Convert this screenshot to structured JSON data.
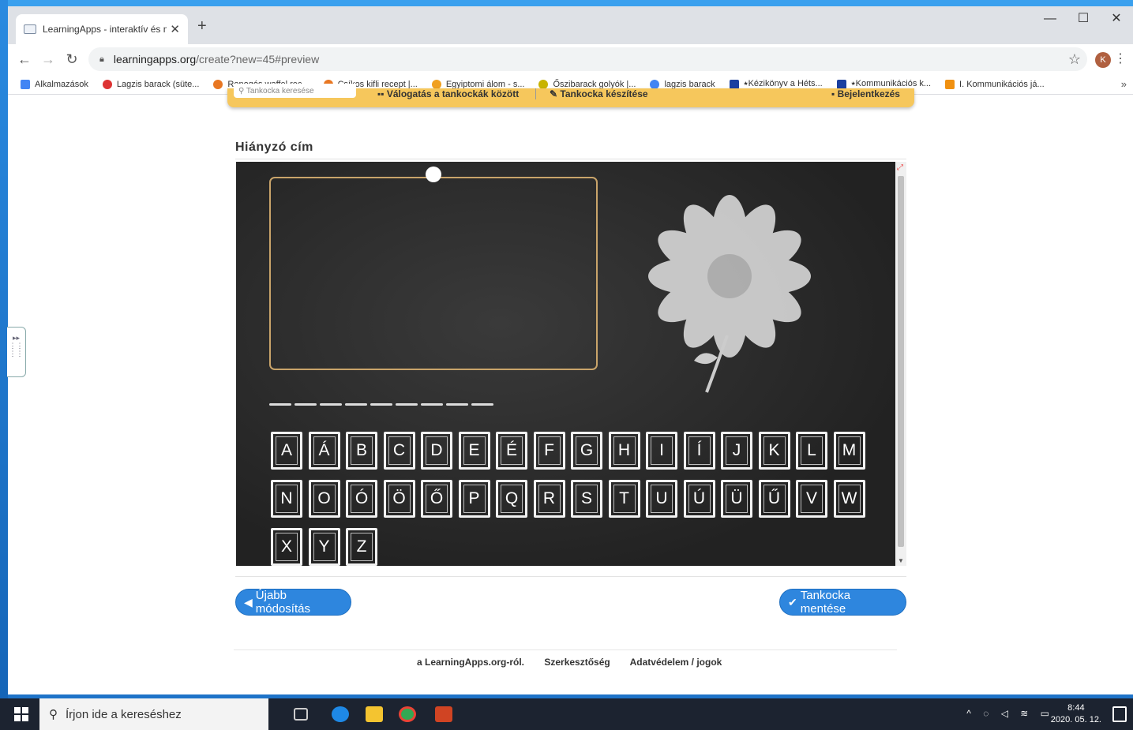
{
  "browser": {
    "tab_title": "LearningApps - interaktív és mul",
    "url_host": "learningapps.org",
    "url_path": "/create?new=45#preview",
    "new_tab": "+",
    "profile_initial": "K",
    "bookmarks": [
      {
        "label": "Alkalmazások",
        "color": "#4285f4"
      },
      {
        "label": "Lagzis barack (süte...",
        "color": "#d33"
      },
      {
        "label": "Ropogós waffel rec...",
        "color": "#e87722"
      },
      {
        "label": "Csíkos kifli recept |...",
        "color": "#e87722"
      },
      {
        "label": "Egyiptomi álom - s...",
        "color": "#f0a020"
      },
      {
        "label": "Őszibarack golyók |...",
        "color": "#c8b400"
      },
      {
        "label": "lagzis barack",
        "color": "#4285f4"
      },
      {
        "label": "⭑Kézikönyv a Héts...",
        "color": "#1a3fa0"
      },
      {
        "label": "⭑Kommunikációs k...",
        "color": "#1a3fa0"
      },
      {
        "label": "I. Kommunikációs já...",
        "color": "#f09010"
      }
    ],
    "bookmarks_more": "»"
  },
  "site_nav": {
    "search_placeholder": "Tankocka keresése",
    "browse": "Válogatás a tankockák között",
    "create": "Tankocka készítése",
    "login": "Bejelentkezés"
  },
  "app": {
    "title": "Hiányzó cím",
    "dash_count": 9,
    "keys": [
      "A",
      "Á",
      "B",
      "C",
      "D",
      "E",
      "É",
      "F",
      "G",
      "H",
      "I",
      "Í",
      "J",
      "K",
      "L",
      "M",
      "N",
      "O",
      "Ó",
      "Ö",
      "Ő",
      "P",
      "Q",
      "R",
      "S",
      "T",
      "U",
      "Ú",
      "Ü",
      "Ű",
      "V",
      "W",
      "X",
      "Y",
      "Z"
    ]
  },
  "actions": {
    "back_label": "Újabb módosítás",
    "save_label": "Tankocka mentése"
  },
  "footer": {
    "about": "a LearningApps.org-ról.",
    "editorial": "Szerkesztőség",
    "privacy": "Adatvédelem / jogok"
  },
  "taskbar": {
    "search_placeholder": "Írjon ide a kereséshez",
    "time": "8:44",
    "date": "2020. 05. 12."
  },
  "colors": {
    "accent_button": "#2e86de",
    "nav_bar": "#f6c75c",
    "chalkboard": "#2b2b2b",
    "frame": "#c9a46a"
  }
}
